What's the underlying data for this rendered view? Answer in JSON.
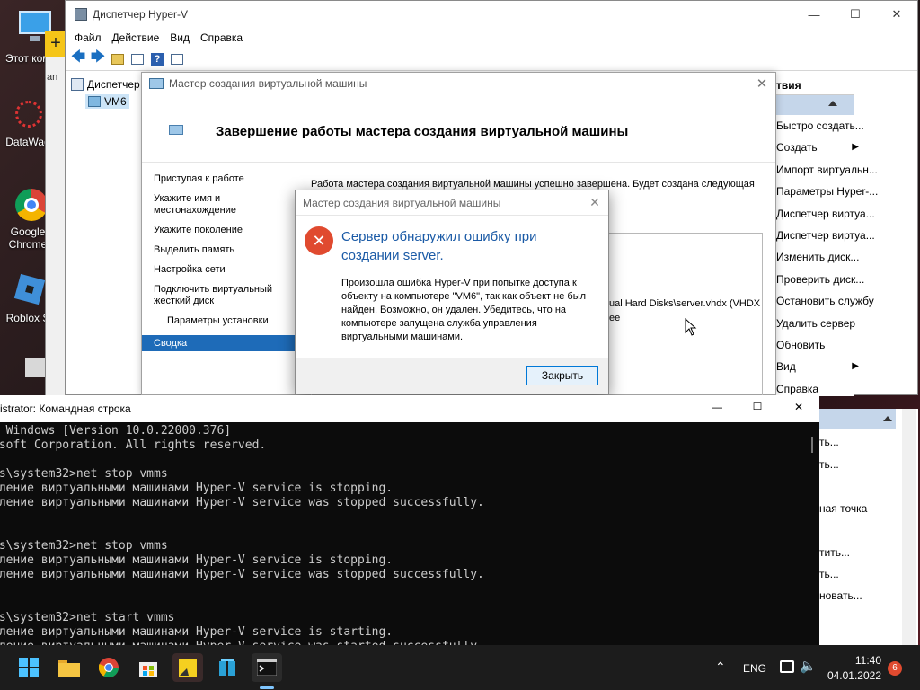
{
  "desktop": {
    "icons": [
      {
        "label": "Этот компьютер",
        "icon": "computer-icon"
      },
      {
        "label": "DataWag",
        "icon": "datawag-icon"
      },
      {
        "label": "Google Chrome",
        "icon": "chrome-icon"
      },
      {
        "label": "Roblox S",
        "icon": "roblox-icon"
      }
    ]
  },
  "hyperv": {
    "title": "Диспетчер Hyper-V",
    "menu": [
      "Файл",
      "Действие",
      "Вид",
      "Справка"
    ],
    "tree": {
      "root": "Диспетчер",
      "child": "VM6"
    },
    "actions_header": "твия",
    "actions": [
      "Быстро создать...",
      "Создать",
      "Импорт виртуальн...",
      "Параметры Hyper-...",
      "Диспетчер виртуа...",
      "Диспетчер виртуа...",
      "Изменить диск...",
      "Проверить диск...",
      "Остановить службу",
      "Удалить сервер",
      "Обновить",
      "Вид",
      "Справка"
    ],
    "actions2": [
      "ть...",
      "ть...",
      "ная точка",
      "тить...",
      "ть...",
      "новать..."
    ]
  },
  "wizard": {
    "window_title": "Мастер создания виртуальной машины",
    "heading": "Завершение работы мастера создания виртуальной машины",
    "nav": [
      "Приступая к работе",
      "Укажите имя и местонахождение",
      "Укажите поколение",
      "Выделить память",
      "Настройка сети",
      "Подключить виртуальный жесткий диск",
      "Параметры установки",
      "Сводка"
    ],
    "summary_text": "Работа мастера создания виртуальной машины успешно завершена. Будет создана следующая",
    "vhd_path": "ual Hard Disks\\server.vhdx (VHDX d",
    "vhd_note": "ee"
  },
  "error_dialog": {
    "title": "Мастер создания виртуальной машины",
    "heading": "Сервер обнаружил ошибку при создании server.",
    "message": "Произошла ошибка Hyper-V при попытке доступа к объекту на компьютере \"VM6\", так как объект не был найден. Возможно, он удален. Убедитесь, что на компьютере запущена служба управления виртуальными машинами.",
    "close_button": "Закрыть"
  },
  "cmd": {
    "title": "istrator: Командная строка",
    "output": "t Windows [Version 10.0.22000.376]\nosoft Corporation. All rights reserved.\n\nws\\system32>net stop vmms\nвление виртуальными машинами Hyper-V service is stopping.\nвление виртуальными машинами Hyper-V service was stopped successfully.\n\n\nws\\system32>net stop vmms\nвление виртуальными машинами Hyper-V service is stopping.\nвление виртуальными машинами Hyper-V service was stopped successfully.\n\n\nws\\system32>net start vmms\nвление виртуальными машинами Hyper-V service is starting.\nвление виртуальными машинами Hyper-V service was started successfully."
  },
  "taskbar": {
    "lang": "ENG",
    "time": "11:40",
    "date": "04.01.2022",
    "notifications": "6"
  },
  "colors": {
    "accent": "#1e6bb8",
    "error": "#e04a2f",
    "heading_blue": "#1a5aa6",
    "actions_header": "#c5d6ea"
  }
}
